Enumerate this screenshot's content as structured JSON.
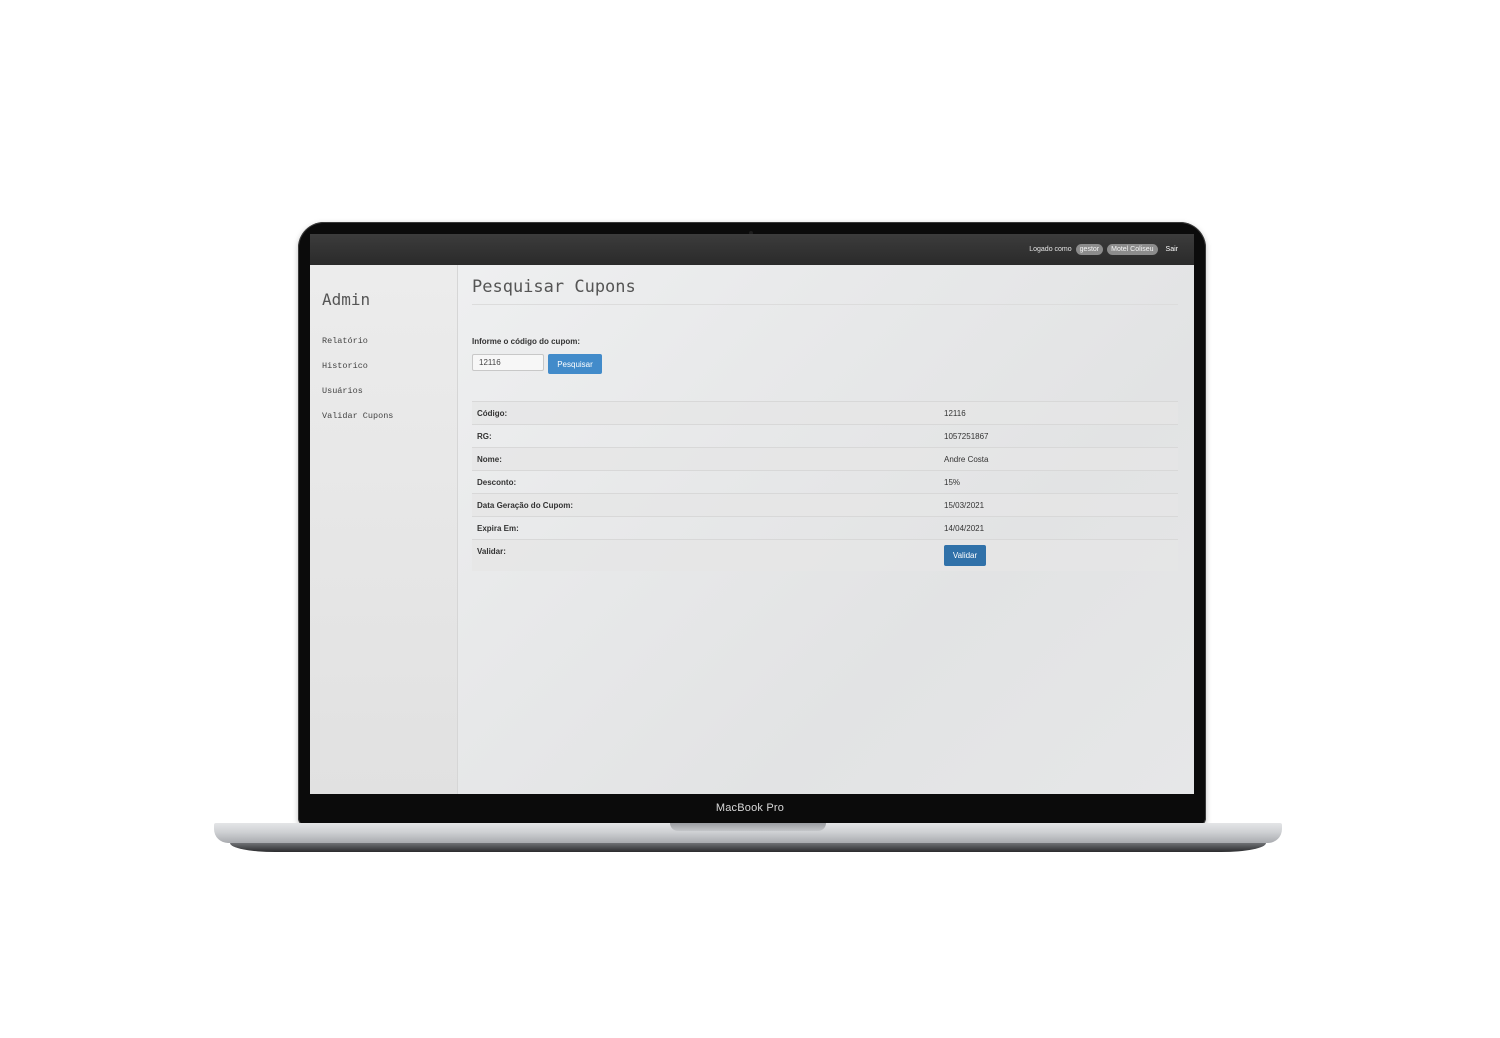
{
  "device": {
    "model_label": "MacBook Pro"
  },
  "topbar": {
    "logged_as_label": "Logado como",
    "user_badge": "gestor",
    "company_badge": "Motel Coliseu",
    "logout_label": "Sair"
  },
  "sidebar": {
    "brand": "Admin",
    "items": [
      {
        "label": "Relatório"
      },
      {
        "label": "Historico"
      },
      {
        "label": "Usuários"
      },
      {
        "label": "Validar Cupons"
      }
    ]
  },
  "main": {
    "title": "Pesquisar Cupons",
    "search": {
      "label": "Informe o código do cupom:",
      "value": "12116",
      "button_label": "Pesquisar"
    },
    "details": [
      {
        "label": "Código:",
        "value": "12116"
      },
      {
        "label": "RG:",
        "value": "1057251867"
      },
      {
        "label": "Nome:",
        "value": "Andre Costa"
      },
      {
        "label": "Desconto:",
        "value": "15%"
      },
      {
        "label": "Data Geração do Cupom:",
        "value": "15/03/2021"
      },
      {
        "label": "Expira Em:",
        "value": "14/04/2021"
      }
    ],
    "validate": {
      "label": "Validar:",
      "button_label": "Validar"
    }
  }
}
